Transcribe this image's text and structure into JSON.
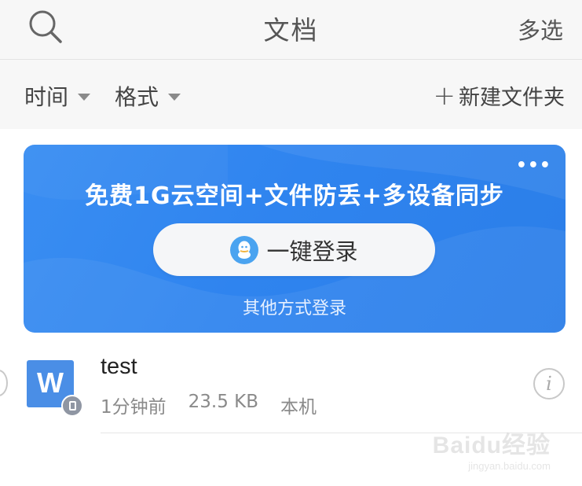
{
  "navbar": {
    "title": "文档",
    "multiselect_label": "多选",
    "search_icon": "search-icon"
  },
  "toolbar": {
    "filter_time_label": "时间",
    "filter_format_label": "格式",
    "new_folder_label": "新建文件夹",
    "new_folder_plus": "+"
  },
  "banner": {
    "headline": "免费1G云空间+文件防丢+多设备同步",
    "more_label": "•••",
    "login_button_label": "一键登录",
    "other_login_label": "其他方式登录",
    "colors": {
      "background": "#2f84ef",
      "button": "#f5f6f8",
      "qq_badge": "#4aa3f0"
    }
  },
  "files": [
    {
      "name": "test",
      "icon_letter": "W",
      "modified": "1分钟前",
      "size": "23.5 KB",
      "location": "本机",
      "icon_color": "#4a8ee6"
    }
  ],
  "info_glyph": "i",
  "watermark": {
    "main": "Baidu经验",
    "sub": "jingyan.baidu.com"
  }
}
